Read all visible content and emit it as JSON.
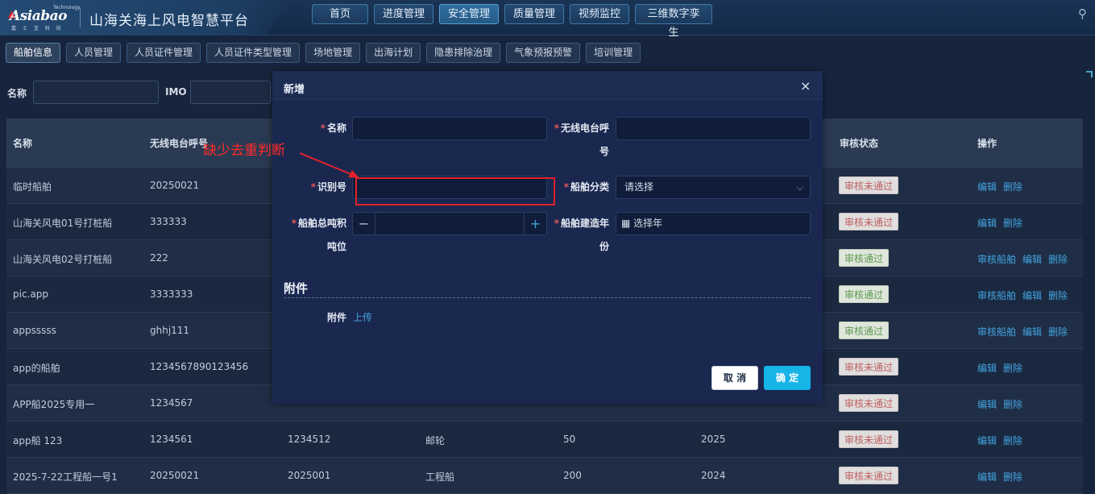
{
  "header": {
    "logo_brand": "Asiabao",
    "logo_tech": "Technology",
    "logo_sub": "嘉 士 宝 科 技",
    "title": "山海关海上风电智慧平台",
    "nav": [
      {
        "label": "首页"
      },
      {
        "label": "进度管理"
      },
      {
        "label": "安全管理"
      },
      {
        "label": "质量管理"
      },
      {
        "label": "视频监控"
      },
      {
        "label": "三维数字孪生"
      }
    ],
    "active_nav": "安全管理"
  },
  "sub_nav": [
    {
      "label": "船舶信息"
    },
    {
      "label": "人员管理"
    },
    {
      "label": "人员证件管理"
    },
    {
      "label": "人员证件类型管理"
    },
    {
      "label": "场地管理"
    },
    {
      "label": "出海计划"
    },
    {
      "label": "隐患排除治理"
    },
    {
      "label": "气象预报预警"
    },
    {
      "label": "培训管理"
    }
  ],
  "search": {
    "name_label": "名称",
    "imo_label": "IMO"
  },
  "table": {
    "columns": [
      "名称",
      "无线电台呼号",
      "审核状态",
      "操作"
    ],
    "rows": [
      {
        "name": "临时船舶",
        "call": "20250021",
        "c3": "",
        "c4": "",
        "c5": "",
        "c6": "",
        "status": "审核未通过",
        "pass": false,
        "actions": [
          "编辑",
          "删除"
        ]
      },
      {
        "name": "山海关风电01号打桩船",
        "call": "333333",
        "c3": "",
        "c4": "",
        "c5": "",
        "c6": "",
        "status": "审核未通过",
        "pass": false,
        "actions": [
          "编辑",
          "删除"
        ]
      },
      {
        "name": "山海关风电02号打桩船",
        "call": "222",
        "c3": "",
        "c4": "",
        "c5": "",
        "c6": "",
        "status": "审核通过",
        "pass": true,
        "actions": [
          "审核船舶",
          "编辑",
          "删除"
        ]
      },
      {
        "name": "pic.app",
        "call": "3333333",
        "c3": "",
        "c4": "",
        "c5": "",
        "c6": "",
        "status": "审核通过",
        "pass": true,
        "actions": [
          "审核船舶",
          "编辑",
          "删除"
        ]
      },
      {
        "name": "appsssss",
        "call": "ghhj111",
        "c3": "",
        "c4": "",
        "c5": "",
        "c6": "",
        "status": "审核通过",
        "pass": true,
        "actions": [
          "审核船舶",
          "编辑",
          "删除"
        ]
      },
      {
        "name": "app的船舶",
        "call": "1234567890123456",
        "c3": "",
        "c4": "",
        "c5": "",
        "c6": "",
        "status": "审核未通过",
        "pass": false,
        "actions": [
          "编辑",
          "删除"
        ]
      },
      {
        "name": "APP船2025专用一",
        "call": "1234567",
        "c3": "",
        "c4": "",
        "c5": "",
        "c6": "",
        "status": "审核未通过",
        "pass": false,
        "actions": [
          "编辑",
          "删除"
        ]
      },
      {
        "name": "app船 123",
        "call": "1234561",
        "c3": "1234512",
        "c4": "邮轮",
        "c5": "50",
        "c6": "2025",
        "status": "审核未通过",
        "pass": false,
        "actions": [
          "编辑",
          "删除"
        ]
      },
      {
        "name": "2025-7-22工程船一号1",
        "call": "20250021",
        "c3": "2025001",
        "c4": "工程船",
        "c5": "200",
        "c6": "2024",
        "status": "审核未通过",
        "pass": false,
        "actions": [
          "编辑",
          "删除"
        ]
      }
    ]
  },
  "modal": {
    "title": "新增",
    "close": "×",
    "fields": {
      "name_label": "名称",
      "call_label_1": "无线电台呼",
      "call_label_2": "号",
      "id_label": "识别号",
      "class_label": "船舶分类",
      "class_placeholder": "请选择",
      "tonnage_label_1": "船舶总吨积",
      "tonnage_label_2": "吨位",
      "year_label_1": "船舶建造年",
      "year_label_2": "份",
      "year_placeholder": "选择年"
    },
    "section_title": "附件",
    "attach_label": "附件",
    "upload_label": "上传",
    "cancel_label": "取 消",
    "ok_label": "确 定"
  },
  "annotation": {
    "text": "缺少去重判断",
    "color": "#ff2a2a"
  },
  "colors": {
    "accent": "#17b4e8",
    "link": "#43a3df",
    "required": "#e25656"
  }
}
